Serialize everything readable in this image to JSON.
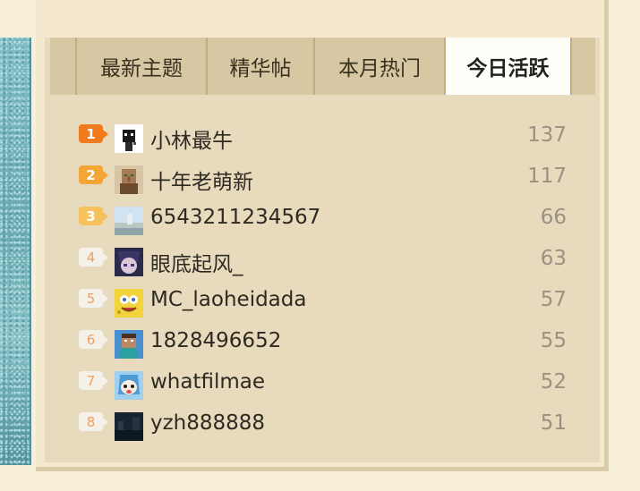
{
  "tabs": [
    {
      "label": "最新主题",
      "active": false
    },
    {
      "label": "精华帖",
      "active": false
    },
    {
      "label": "本月热门",
      "active": false
    },
    {
      "label": "今日活跃",
      "active": true
    }
  ],
  "ranking": [
    {
      "rank": "1",
      "name": "小林最牛",
      "count": "137",
      "avatar": "black-white-creeper-avatar"
    },
    {
      "rank": "2",
      "name": "十年老萌新",
      "count": "117",
      "avatar": "minecraft-villager-avatar"
    },
    {
      "rank": "3",
      "name": "6543211234567",
      "count": "66",
      "avatar": "landscape-avatar"
    },
    {
      "rank": "4",
      "name": "眼底起风_",
      "count": "63",
      "avatar": "anime-character-avatar"
    },
    {
      "rank": "5",
      "name": "MC_laoheidada",
      "count": "57",
      "avatar": "spongebob-avatar"
    },
    {
      "rank": "6",
      "name": "1828496652",
      "count": "55",
      "avatar": "minecraft-steve-avatar"
    },
    {
      "rank": "7",
      "name": "whatfilmae",
      "count": "52",
      "avatar": "anime-squid-girl-avatar"
    },
    {
      "rank": "8",
      "name": "yzh888888",
      "count": "51",
      "avatar": "dark-scene-avatar"
    }
  ],
  "colors": {
    "rank1": "#f07a1c",
    "rank2": "#f3a636",
    "rank3": "#f6c25e",
    "panel": "#e8dbbd",
    "tabbar": "#d7c7a3",
    "activeTab": "#fffdf8"
  }
}
